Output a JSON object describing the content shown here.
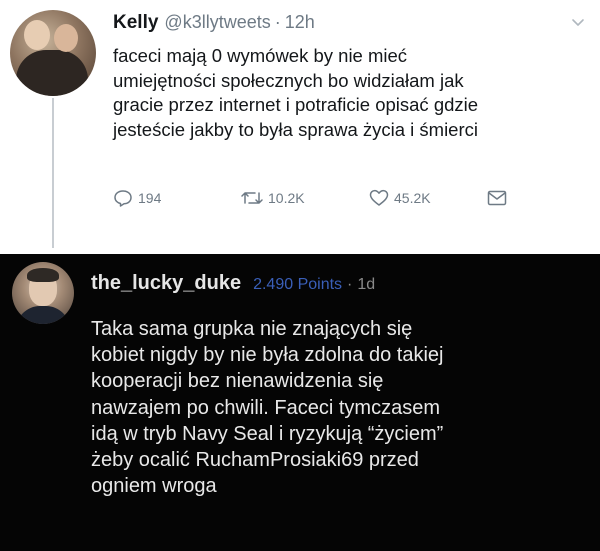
{
  "tweet": {
    "author_name": "Kelly",
    "author_handle": "@k3llytweets",
    "time_separator": "·",
    "time": "12h",
    "text_lines": [
      "faceci mają 0 wymówek by nie mieć",
      "umiejętności społecznych bo widziałam jak",
      "gracie przez internet i potraficie opisać gdzie",
      "jesteście jakby to była sprawa życia i śmierci"
    ],
    "actions": {
      "reply_icon": "reply-icon",
      "reply_count": "194",
      "retweet_icon": "retweet-icon",
      "retweet_count": "10.2K",
      "like_icon": "heart-icon",
      "like_count": "45.2K",
      "message_icon": "envelope-icon"
    },
    "menu_icon": "chevron-down-icon"
  },
  "comment": {
    "username": "the_lucky_duke",
    "points": "2.490 Points",
    "age_separator": "·",
    "age": "1d",
    "text_lines": [
      "Taka sama grupka nie znających się",
      "kobiet nigdy by nie była zdolna do takiej",
      "kooperacji bez nienawidzenia się",
      "nawzajem po chwili. Faceci tymczasem",
      "idą w tryb Navy Seal i ryzykują “życiem”",
      "żeby ocalić RuchamProsiaki69 przed",
      "ogniem wroga"
    ]
  },
  "colors": {
    "tweet_background": "#ffffff",
    "tweet_text": "#14171a",
    "tweet_secondary": "#6e7a85",
    "comment_background": "#050505",
    "comment_text": "#e8e8e8",
    "points_accent": "#3a5fb8"
  }
}
